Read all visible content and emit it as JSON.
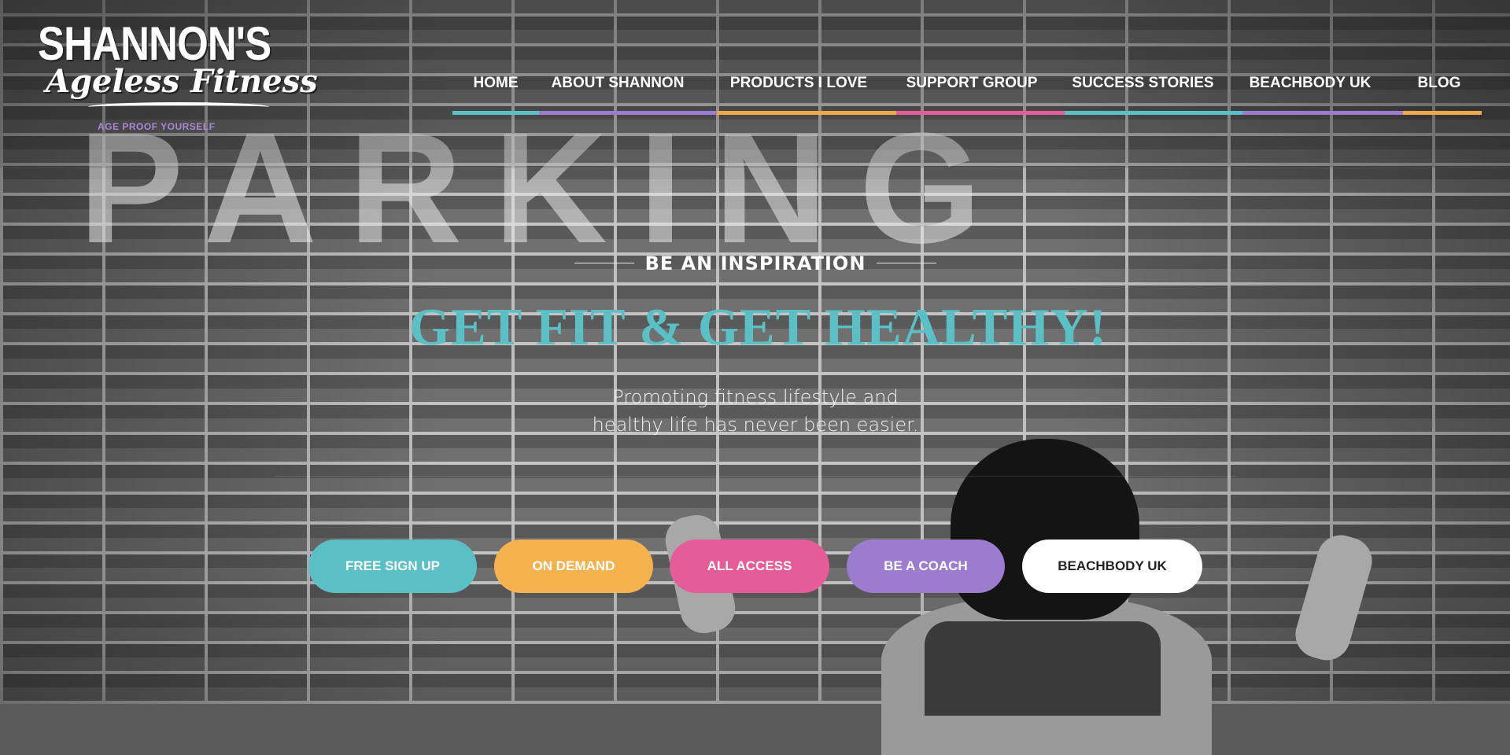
{
  "logo": {
    "line1": "SHANNON'S",
    "line2": "Ageless Fitness",
    "tagline": "AGE PROOF YOURSELF"
  },
  "background": {
    "ghost_text": "PARKING"
  },
  "nav": {
    "items": [
      {
        "label": "HOME",
        "color": "#5bbfc6"
      },
      {
        "label": "ABOUT SHANNON",
        "color": "#9b7ccf"
      },
      {
        "label": "PRODUCTS I LOVE",
        "color": "#f0a84a",
        "has_dropdown": true
      },
      {
        "label": "SUPPORT GROUP",
        "color": "#e55c98"
      },
      {
        "label": "SUCCESS STORIES",
        "color": "#5bbfc6"
      },
      {
        "label": "BEACHBODY UK",
        "color": "#9b7ccf"
      },
      {
        "label": "BLOG",
        "color": "#f0a84a"
      }
    ]
  },
  "hero": {
    "kicker": "BE AN INSPIRATION",
    "headline": "GET FIT & GET HEALTHY!",
    "subtext_line1": "Promoting fitness lifestyle and",
    "subtext_line2": "healthy life has never been easier."
  },
  "buttons": [
    {
      "label": "FREE SIGN UP",
      "bg": "#5bbfc6",
      "fg": "#ffffff"
    },
    {
      "label": "ON DEMAND",
      "bg": "#f6b24f",
      "fg": "#ffffff"
    },
    {
      "label": "ALL ACCESS",
      "bg": "#e55c98",
      "fg": "#ffffff"
    },
    {
      "label": "BE A COACH",
      "bg": "#9b7ccf",
      "fg": "#ffffff"
    },
    {
      "label": "BEACHBODY UK",
      "bg": "#ffffff",
      "fg": "#222222"
    }
  ]
}
